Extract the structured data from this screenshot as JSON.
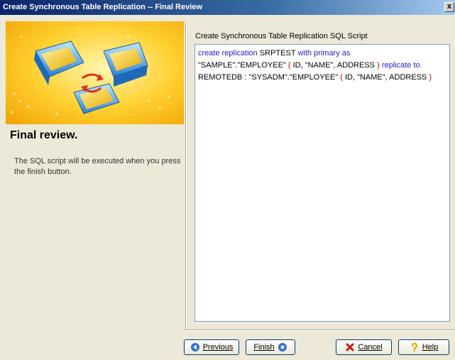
{
  "window": {
    "title": "Create Synchronous Table Replication -- Final Review",
    "close_glyph": "x"
  },
  "left": {
    "heading": "Final review.",
    "description": "The SQL script will be executed when you press the finish button.",
    "banner_icon": "replication-banner"
  },
  "script": {
    "label": "Create Synchronous Table Replication SQL Script",
    "line1": {
      "kw1": "create replication",
      "name": "SRPTEST",
      "kw2": "with primary as"
    },
    "line2": {
      "table": "\"SAMPLE\".\"EMPLOYEE\"",
      "open": "(",
      "cols": "ID, \"NAME\", ADDRESS",
      "close": ")",
      "kw": "replicate to"
    },
    "line3": {
      "target": "REMOTEDB : \"SYSADM\".\"EMPLOYEE\"",
      "open": "(",
      "cols": "ID, \"NAME\", ADDRESS",
      "close": ")"
    }
  },
  "buttons": {
    "previous": "Previous",
    "finish": "Finish",
    "cancel": "Cancel",
    "help": "Help"
  },
  "icons": {
    "previous": "arrow-left-icon",
    "finish": "finish-icon",
    "cancel": "red-x-icon",
    "help": "question-mark-icon"
  },
  "colors": {
    "keyword": "#1c1cd0",
    "paren": "#c00000",
    "title_bar": "#0a246a"
  }
}
